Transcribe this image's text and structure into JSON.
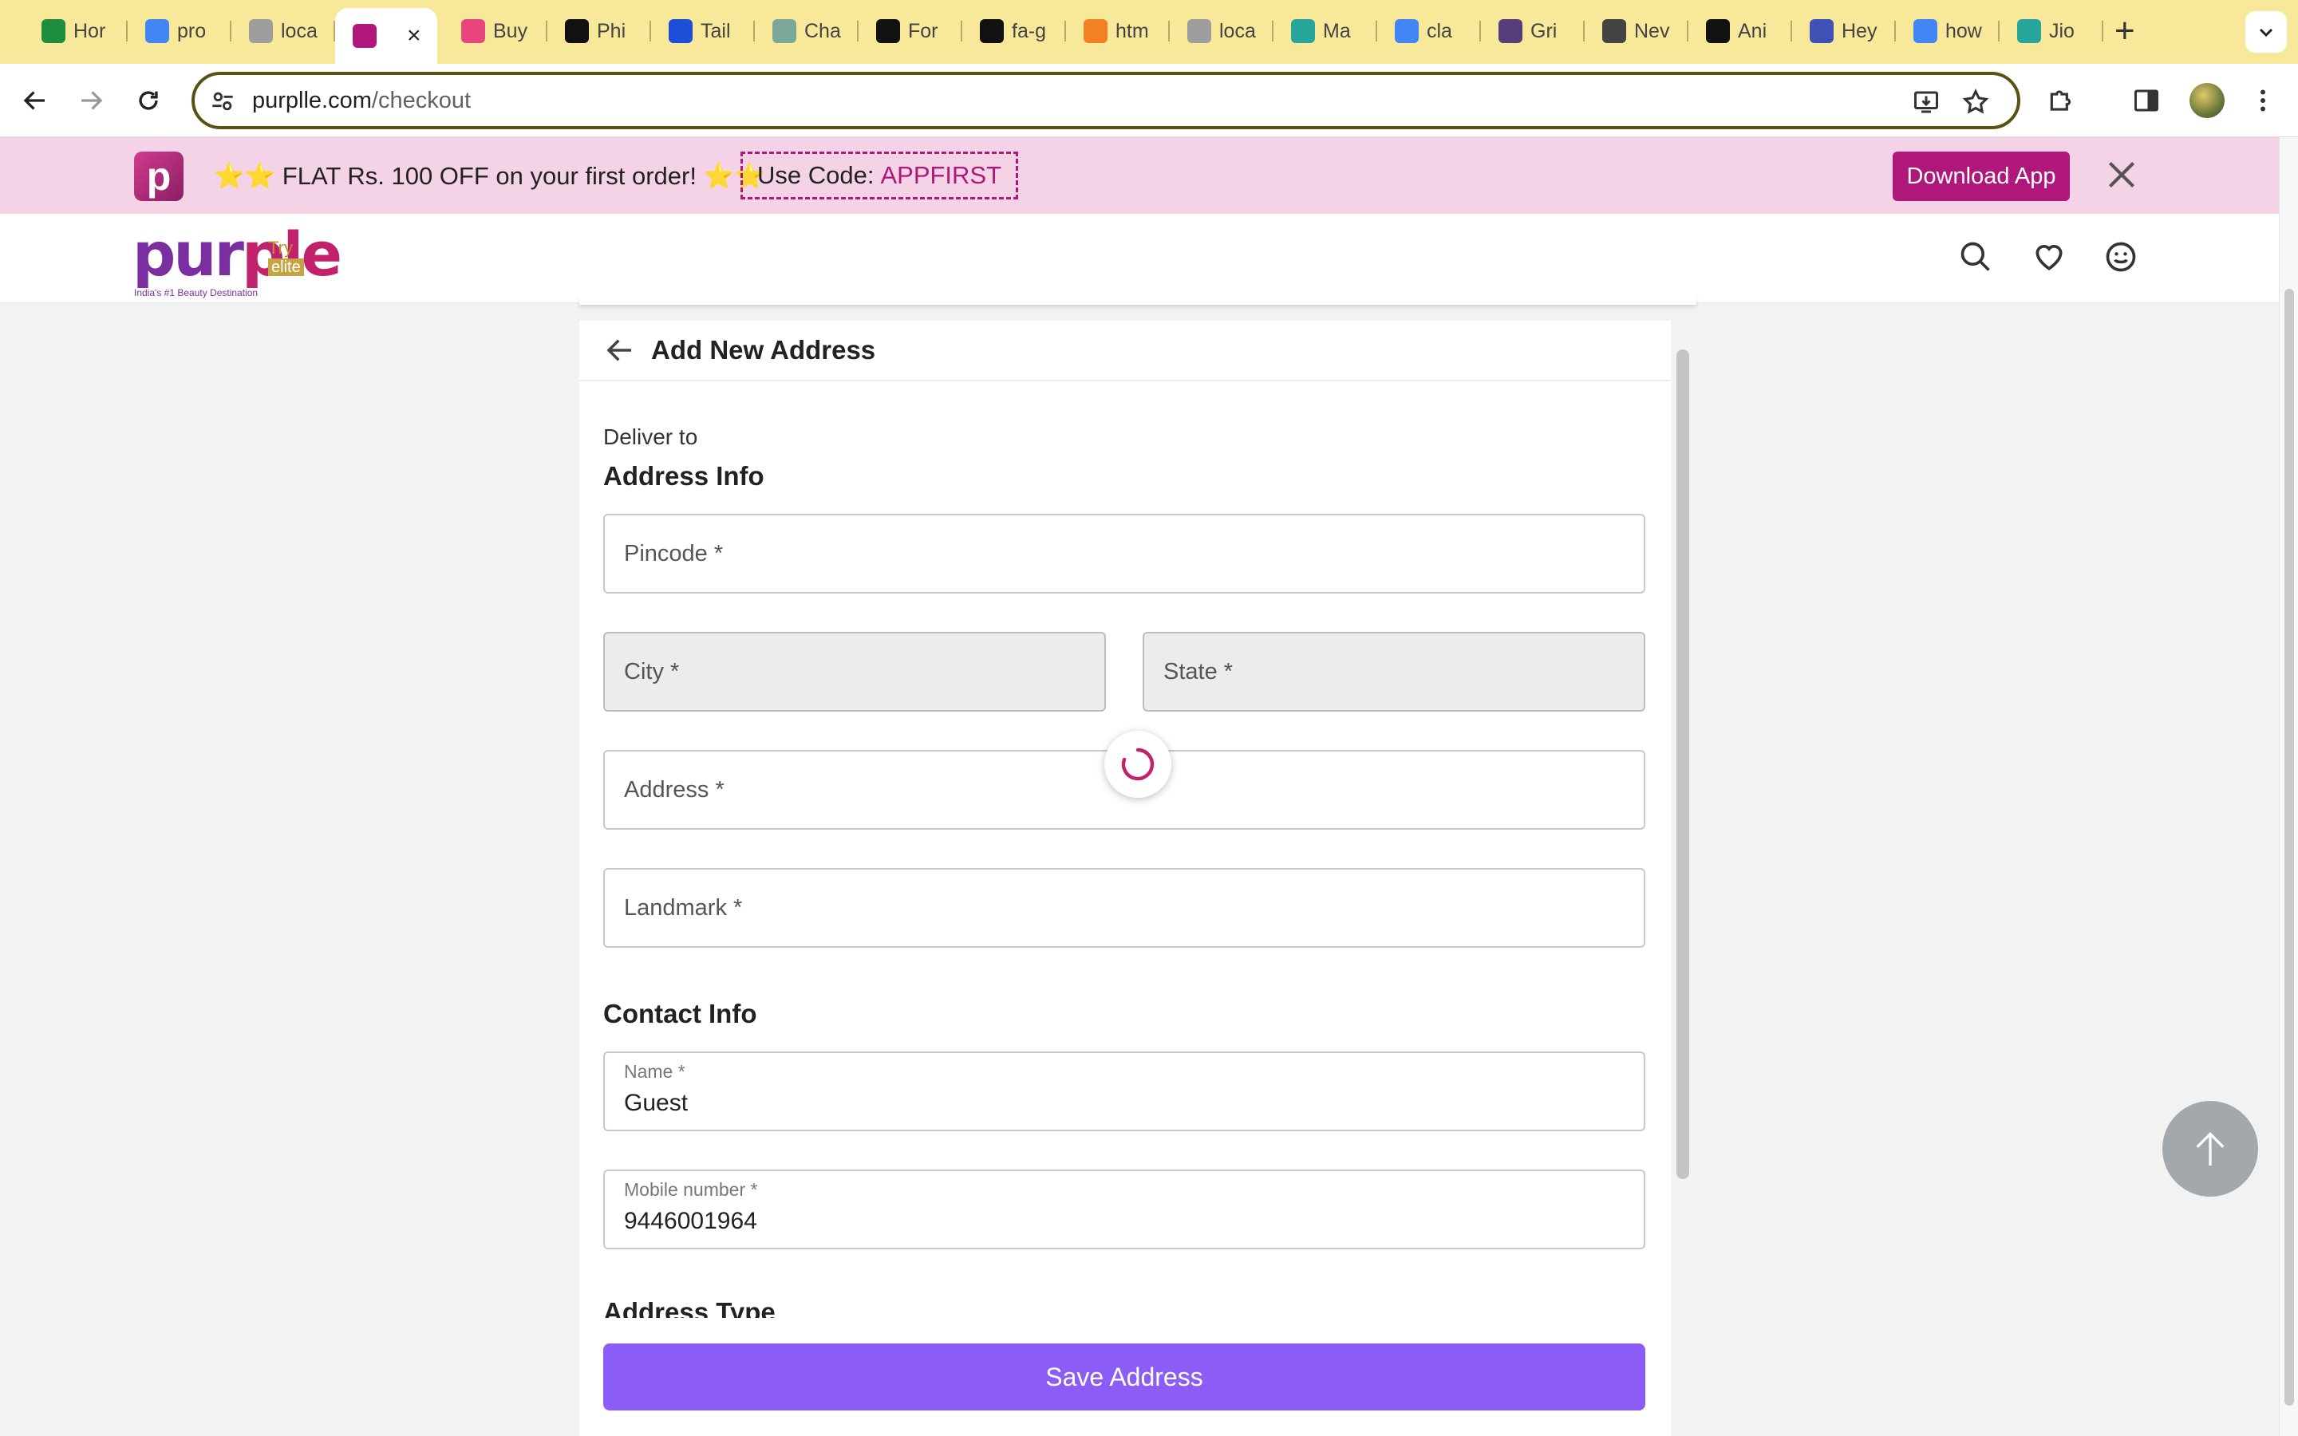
{
  "browser": {
    "tabs": [
      {
        "label": "Hor",
        "icon": "google-drive-icon",
        "color": "#1e8e3e"
      },
      {
        "label": "pro",
        "icon": "google-docs-icon",
        "color": "#4285f4"
      },
      {
        "label": "loca",
        "icon": "generic-site-icon",
        "color": "#9e9e9e"
      },
      {
        "label": "",
        "icon": "purplle-icon",
        "color": "#b0177a",
        "active": true
      },
      {
        "label": "Buy",
        "icon": "nykaa-icon",
        "color": "#e8457c"
      },
      {
        "label": "Phi",
        "icon": "purplle-dark-icon",
        "color": "#111111"
      },
      {
        "label": "Tail",
        "icon": "tailwind-icon",
        "color": "#1d4ed8"
      },
      {
        "label": "Cha",
        "icon": "chatgpt-icon",
        "color": "#7aa89a"
      },
      {
        "label": "For",
        "icon": "flag-icon",
        "color": "#111111"
      },
      {
        "label": "fa-g",
        "icon": "flag-icon",
        "color": "#111111"
      },
      {
        "label": "htm",
        "icon": "stackoverflow-icon",
        "color": "#f48024"
      },
      {
        "label": "loca",
        "icon": "generic-site-icon",
        "color": "#9e9e9e"
      },
      {
        "label": "Ma",
        "icon": "leaf-icon",
        "color": "#26a69a"
      },
      {
        "label": "cla",
        "icon": "google-icon",
        "color": "#4285f4"
      },
      {
        "label": "Gri",
        "icon": "bootstrap-icon",
        "color": "#563d7c"
      },
      {
        "label": "Nev",
        "icon": "chrome-icon",
        "color": "#444444"
      },
      {
        "label": "Ani",
        "icon": "codepen-icon",
        "color": "#111111"
      },
      {
        "label": "Hey",
        "icon": "generic-site-icon",
        "color": "#3f51b5"
      },
      {
        "label": "how",
        "icon": "google-icon",
        "color": "#4285f4"
      },
      {
        "label": "Jio",
        "icon": "leaf-icon",
        "color": "#26a69a"
      }
    ],
    "url_domain": "purplle.com",
    "url_path": "/checkout"
  },
  "promo": {
    "logo_letter": "p",
    "text": "⭐⭐ FLAT Rs. 100 OFF on your first order! ⭐⭐",
    "code_label": "Use Code:",
    "code_value": "APPFIRST",
    "download_label": "Download App"
  },
  "header": {
    "brand_part1": "pur",
    "brand_part2": "ple",
    "brand_tag": "India's #1 Beauty Destination",
    "try_label": "Try",
    "elite_label": "elite"
  },
  "form": {
    "title": "Add New Address",
    "deliver_to": "Deliver to",
    "address_info_heading": "Address Info",
    "pincode_placeholder": "Pincode *",
    "city_placeholder": "City *",
    "state_placeholder": "State *",
    "address_placeholder": "Address *",
    "landmark_placeholder": "Landmark *",
    "contact_info_heading": "Contact Info",
    "name_label": "Name *",
    "name_value": "Guest",
    "mobile_label": "Mobile number *",
    "mobile_value": "9446001964",
    "address_type_heading": "Address Type",
    "save_label": "Save Address"
  },
  "colors": {
    "brand": "#b0177a",
    "save_button": "#8b5cf6",
    "promo_bg": "#f4d3e7",
    "tabbar_bg": "#f7e89a"
  }
}
